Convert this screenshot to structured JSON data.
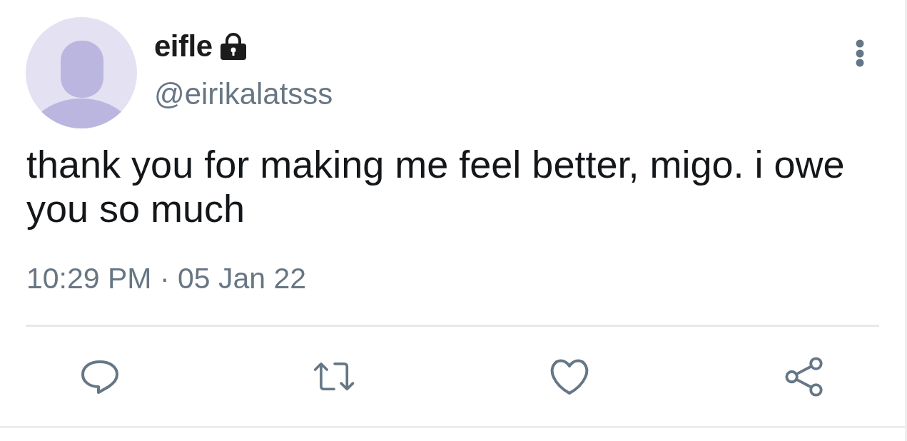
{
  "author": {
    "name": "eifle",
    "protected": true,
    "handle": "@eirikalatsss"
  },
  "tweet": {
    "text": "thank you for making me feel better, migo. i owe you so much",
    "timestamp": "10:29 PM · 05 Jan 22"
  },
  "actions": [
    {
      "kind": "reply"
    },
    {
      "kind": "retweet"
    },
    {
      "kind": "like"
    },
    {
      "kind": "share"
    }
  ]
}
